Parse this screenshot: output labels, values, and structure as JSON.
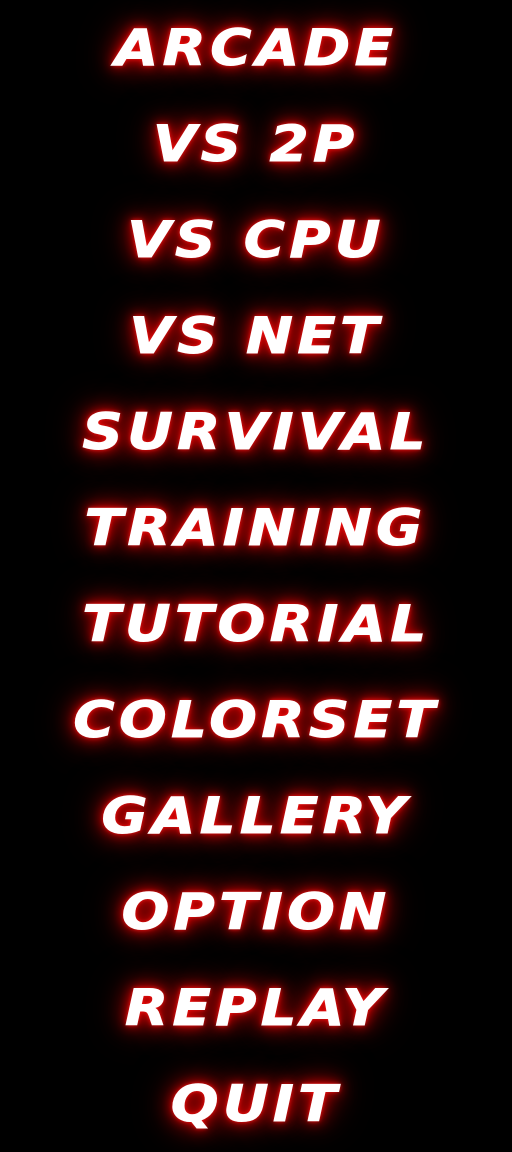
{
  "menu": {
    "items": [
      {
        "label": "ARCADE"
      },
      {
        "label": "VS 2P"
      },
      {
        "label": "VS CPU"
      },
      {
        "label": "VS NET"
      },
      {
        "label": "SURVIVAL"
      },
      {
        "label": "TRAINING"
      },
      {
        "label": "TUTORIAL"
      },
      {
        "label": "COLORSET"
      },
      {
        "label": "GALLERY"
      },
      {
        "label": "OPTION"
      },
      {
        "label": "REPLAY"
      },
      {
        "label": "QUIT"
      }
    ]
  },
  "colors": {
    "background": "#000000",
    "text": "#ffffff",
    "glow": "#e00000"
  }
}
